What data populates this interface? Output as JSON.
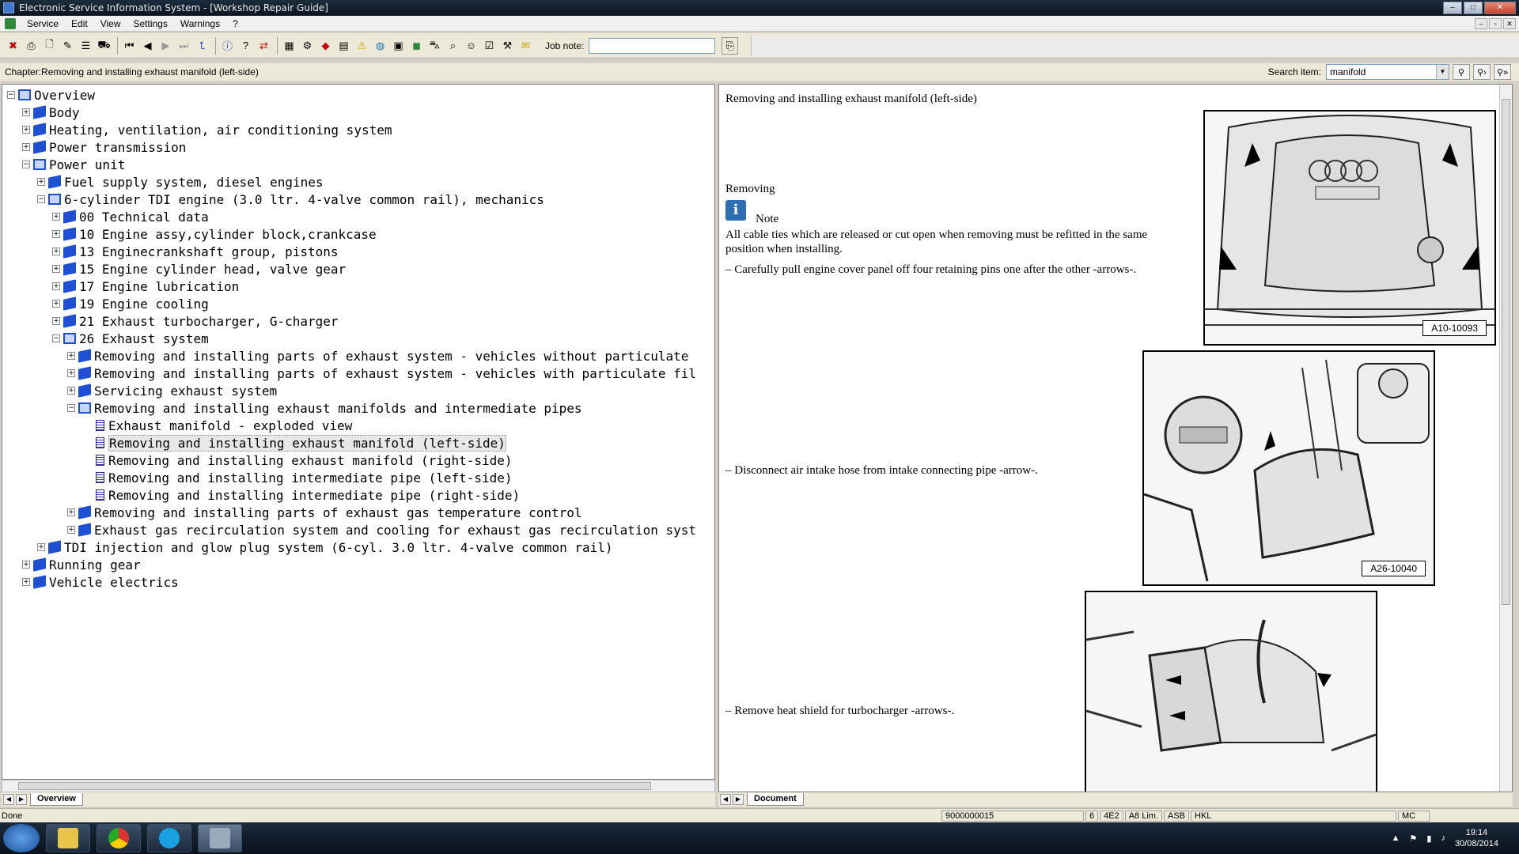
{
  "window": {
    "title": "Electronic Service Information System - [Workshop Repair Guide]"
  },
  "menu": {
    "items": [
      "Service",
      "Edit",
      "View",
      "Settings",
      "Warnings",
      "?"
    ]
  },
  "toolbar": {
    "job_note_label": "Job note:",
    "job_note_value": ""
  },
  "infobar": {
    "chapter": "Chapter:Removing and installing exhaust manifold (left-side)",
    "search_label": "Search item:",
    "search_value": "manifold"
  },
  "tree": {
    "rows": [
      {
        "level": 0,
        "exp": "-",
        "icon": "open-book-icon",
        "label": "Overview"
      },
      {
        "level": 1,
        "exp": "+",
        "icon": "book-icon",
        "label": "Body"
      },
      {
        "level": 1,
        "exp": "+",
        "icon": "book-icon",
        "label": "Heating, ventilation, air conditioning system"
      },
      {
        "level": 1,
        "exp": "+",
        "icon": "book-icon",
        "label": "Power transmission"
      },
      {
        "level": 1,
        "exp": "-",
        "icon": "open-book-icon",
        "label": "Power unit"
      },
      {
        "level": 2,
        "exp": "+",
        "icon": "book-icon",
        "label": "Fuel supply system, diesel engines"
      },
      {
        "level": 2,
        "exp": "-",
        "icon": "open-book-icon",
        "label": "6-cylinder TDI engine (3.0 ltr. 4-valve common rail), mechanics"
      },
      {
        "level": 3,
        "exp": "+",
        "icon": "book-icon",
        "label": "00 Technical data"
      },
      {
        "level": 3,
        "exp": "+",
        "icon": "book-icon",
        "label": "10 Engine assy,cylinder block,crankcase"
      },
      {
        "level": 3,
        "exp": "+",
        "icon": "book-icon",
        "label": "13 Enginecrankshaft group, pistons"
      },
      {
        "level": 3,
        "exp": "+",
        "icon": "book-icon",
        "label": "15 Engine cylinder head, valve gear"
      },
      {
        "level": 3,
        "exp": "+",
        "icon": "book-icon",
        "label": "17 Engine lubrication"
      },
      {
        "level": 3,
        "exp": "+",
        "icon": "book-icon",
        "label": "19 Engine cooling"
      },
      {
        "level": 3,
        "exp": "+",
        "icon": "book-icon",
        "label": "21 Exhaust turbocharger, G-charger"
      },
      {
        "level": 3,
        "exp": "-",
        "icon": "open-book-icon",
        "label": "26 Exhaust system"
      },
      {
        "level": 4,
        "exp": "+",
        "icon": "book-icon",
        "label": "Removing and installing parts of exhaust system - vehicles without particulate"
      },
      {
        "level": 4,
        "exp": "+",
        "icon": "book-icon",
        "label": "Removing and installing parts of exhaust system - vehicles with particulate fil"
      },
      {
        "level": 4,
        "exp": "+",
        "icon": "book-icon",
        "label": "Servicing exhaust system"
      },
      {
        "level": 4,
        "exp": "-",
        "icon": "open-book-icon",
        "label": "Removing and installing exhaust manifolds and intermediate pipes"
      },
      {
        "level": 5,
        "exp": "",
        "icon": "document-icon",
        "label": "Exhaust manifold - exploded view"
      },
      {
        "level": 5,
        "exp": "",
        "icon": "document-icon",
        "label": "Removing and installing exhaust manifold (left-side)",
        "selected": true
      },
      {
        "level": 5,
        "exp": "",
        "icon": "document-icon",
        "label": "Removing and installing exhaust manifold (right-side)"
      },
      {
        "level": 5,
        "exp": "",
        "icon": "document-icon",
        "label": "Removing and installing intermediate pipe (left-side)"
      },
      {
        "level": 5,
        "exp": "",
        "icon": "document-icon",
        "label": "Removing and installing intermediate pipe (right-side)"
      },
      {
        "level": 4,
        "exp": "+",
        "icon": "book-icon",
        "label": "Removing and installing parts of exhaust gas temperature control"
      },
      {
        "level": 4,
        "exp": "+",
        "icon": "book-icon",
        "label": "Exhaust gas recirculation system and cooling for exhaust gas recirculation syst"
      },
      {
        "level": 2,
        "exp": "+",
        "icon": "book-icon",
        "label": "TDI injection and glow plug system (6-cyl. 3.0 ltr. 4-valve common rail)"
      },
      {
        "level": 1,
        "exp": "+",
        "icon": "book-icon",
        "label": "Running gear"
      },
      {
        "level": 1,
        "exp": "+",
        "icon": "book-icon",
        "label": "Vehicle electrics"
      }
    ]
  },
  "left_tab": "Overview",
  "document": {
    "heading": "Removing and installing exhaust manifold (left-side)",
    "removing": "Removing",
    "note": "Note",
    "note_text_1": "All cable ties which are released or cut open when removing must be refitted in the same",
    "note_text_2": "position when installing.",
    "step1": "– Carefully pull engine cover panel off four retaining pins one after the other -arrows-.",
    "step2": "– Disconnect air intake hose from intake connecting pipe -arrow-.",
    "step3": "– Remove heat shield for turbocharger -arrows-.",
    "fig1": "A10-10093",
    "fig2": "A26-10040"
  },
  "right_tab": "Document",
  "status": {
    "text": "Done",
    "cells": [
      "9000000015",
      "6",
      "4E2",
      "A8 Lim.",
      "ASB",
      "HKL",
      "MC"
    ]
  },
  "taskbar": {
    "time": "19:14",
    "date": "30/08/2014"
  }
}
